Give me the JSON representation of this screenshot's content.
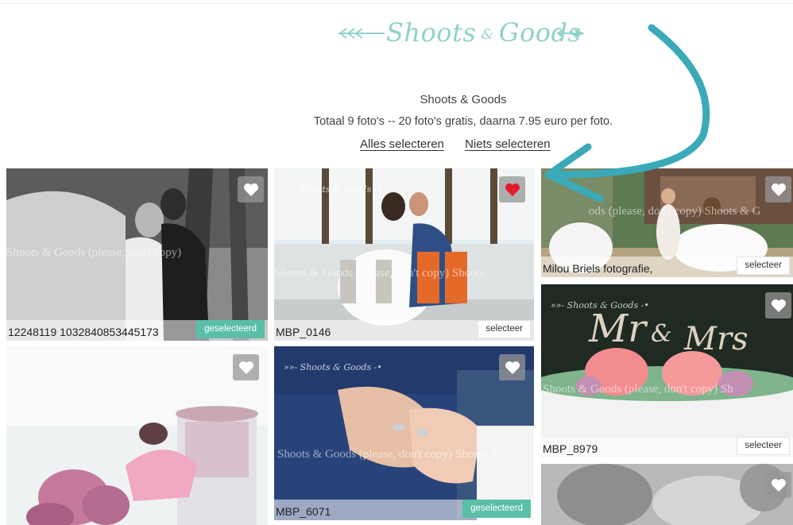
{
  "brand": {
    "name_part1": "Shoots",
    "name_amp": "&",
    "name_part2": "Goods",
    "accent": "#8fd2c8"
  },
  "header": {
    "title": "Shoots & Goods",
    "subtitle": "Totaal 9 foto's -- 20 foto's gratis, daarna 7.95 euro per foto.",
    "select_all": "Alles selecteren",
    "select_none": "Niets selecteren"
  },
  "colors": {
    "selected": "#5bbfa8",
    "heart_active": "#e3192c",
    "arrow": "#3aaab8"
  },
  "photos": [
    {
      "name": "12248119 1032840853445173",
      "button": "geselecteerd",
      "selected": true,
      "favorite": false,
      "watermark_logo": "",
      "watermark_text": "Shoots & Goods (please, don't copy)"
    },
    {
      "name": "MBP_0146",
      "button": "selecteer",
      "selected": false,
      "favorite": true,
      "watermark_logo": "»»- Shoots & Goods -•",
      "watermark_text": "Shoots & Goods (please, don't copy) Shoots"
    },
    {
      "name": "Milou Briels fotografie,",
      "button": "selecteer",
      "selected": false,
      "favorite": false,
      "watermark_logo": "",
      "watermark_text": "ods (please, don't copy) Shoots & G"
    },
    {
      "name": "",
      "button": "",
      "selected": false,
      "favorite": false,
      "watermark_logo": "»»- Shoots & Goods -•",
      "watermark_text": ""
    },
    {
      "name": "MBP_6071",
      "button": "geselecteerd",
      "selected": true,
      "favorite": false,
      "watermark_logo": "»»- Shoots & Goods -•",
      "watermark_text": "Shoots & Goods (please, don't copy) Shoots & Go"
    },
    {
      "name": "MBP_8979",
      "button": "selecteer",
      "selected": false,
      "favorite": false,
      "watermark_logo": "»»- Shoots & Goods -•",
      "watermark_text": "Shoots & Goods (please, don't copy) Sh"
    },
    {
      "name": "",
      "button": "",
      "selected": false,
      "favorite": false,
      "watermark_logo": "",
      "watermark_text": ""
    }
  ],
  "icons": {
    "favorite": "heart-icon",
    "logo_arrow": "arrow-feather-icon",
    "annotation": "curved-arrow-icon"
  }
}
